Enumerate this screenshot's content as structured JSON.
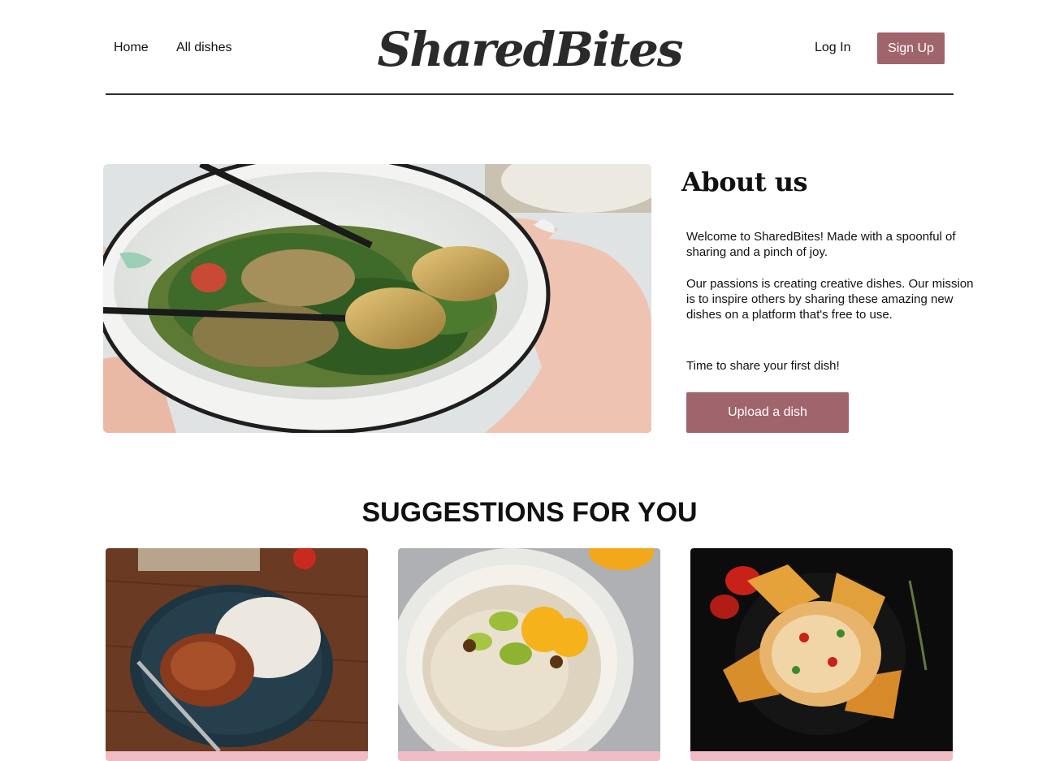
{
  "header": {
    "nav": [
      {
        "label": "Home"
      },
      {
        "label": "All dishes"
      }
    ],
    "logo": "SharedBites",
    "login_label": "Log In",
    "signup_label": "Sign Up"
  },
  "about": {
    "title": "About us",
    "paragraph_1": "Welcome to SharedBites! Made with a spoonful of sharing and a pinch of joy.",
    "paragraph_2": "Our passions is creating creative dishes. Our mission is to inspire others by sharing these amazing new dishes on a platform that's free to use.",
    "paragraph_3": "Time to share your first dish!",
    "upload_label": "Upload a dish"
  },
  "suggestions": {
    "title": "SUGGESTIONS FOR YOU"
  },
  "colors": {
    "accent": "#a0646d",
    "card_band": "#efbcc4",
    "divider": "#2b2b2b"
  }
}
